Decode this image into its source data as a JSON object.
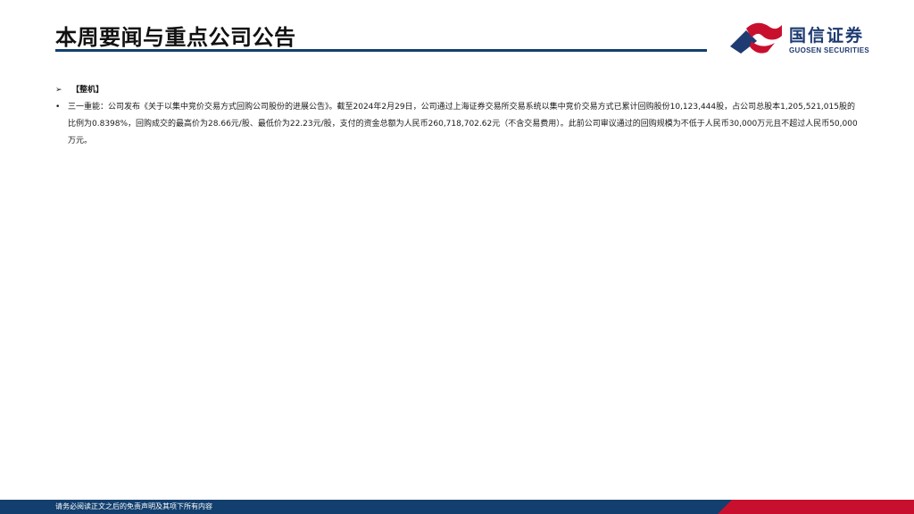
{
  "header": {
    "title": "本周要闻与重点公司公告"
  },
  "logo": {
    "name_cn": "国信证券",
    "name_en": "GUOSEN SECURITIES"
  },
  "section": {
    "marker": "➢",
    "heading": "【整机】"
  },
  "bullet": {
    "marker": "•",
    "text": "三一重能：公司发布《关于以集中竞价交易方式回购公司股份的进展公告》。截至2024年2月29日，公司通过上海证券交易所交易系统以集中竞价交易方式已累计回购股份10,123,444股，占公司总股本1,205,521,015股的比例为0.8398%，回购成交的最高价为28.66元/股、最低价为22.23元/股，支付的资金总额为人民币260,718,702.62元（不含交易费用）。此前公司审议通过的回购规模为不低于人民币30,000万元且不超过人民币50,000万元。"
  },
  "footer": {
    "disclaimer": "请务必阅读正文之后的免责声明及其项下所有内容"
  },
  "colors": {
    "brand_blue": "#1e3c72",
    "rule_blue": "#123f6e",
    "brand_red": "#c8102e"
  }
}
